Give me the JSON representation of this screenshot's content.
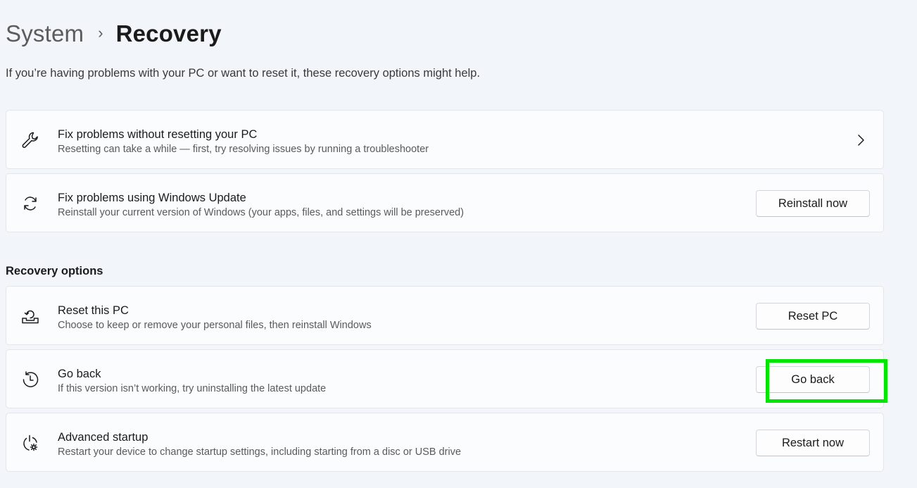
{
  "breadcrumb": {
    "parent": "System",
    "separator": "›",
    "current": "Recovery"
  },
  "description": "If you’re having problems with your PC or want to reset it, these recovery options might help.",
  "top_cards": [
    {
      "title": "Fix problems without resetting your PC",
      "subtitle": "Resetting can take a while — first, try resolving issues by running a troubleshooter",
      "icon": "wrench-icon",
      "action": "chevron-right"
    },
    {
      "title": "Fix problems using Windows Update",
      "subtitle": "Reinstall your current version of Windows (your apps, files, and settings will be preserved)",
      "icon": "refresh-icon",
      "button_label": "Reinstall now"
    }
  ],
  "recovery_options": {
    "heading": "Recovery options",
    "items": [
      {
        "title": "Reset this PC",
        "subtitle": "Choose to keep or remove your personal files, then reinstall Windows",
        "icon": "reset-pc-icon",
        "button_label": "Reset PC"
      },
      {
        "title": "Go back",
        "subtitle": "If this version isn’t working, try uninstalling the latest update",
        "icon": "history-icon",
        "button_label": "Go back"
      },
      {
        "title": "Advanced startup",
        "subtitle": "Restart your device to change startup settings, including starting from a disc or USB drive",
        "icon": "advanced-startup-icon",
        "button_label": "Restart now"
      }
    ]
  },
  "colors": {
    "background": "#f2f5f9",
    "card": "#fbfcfd",
    "highlight": "#00e600"
  }
}
